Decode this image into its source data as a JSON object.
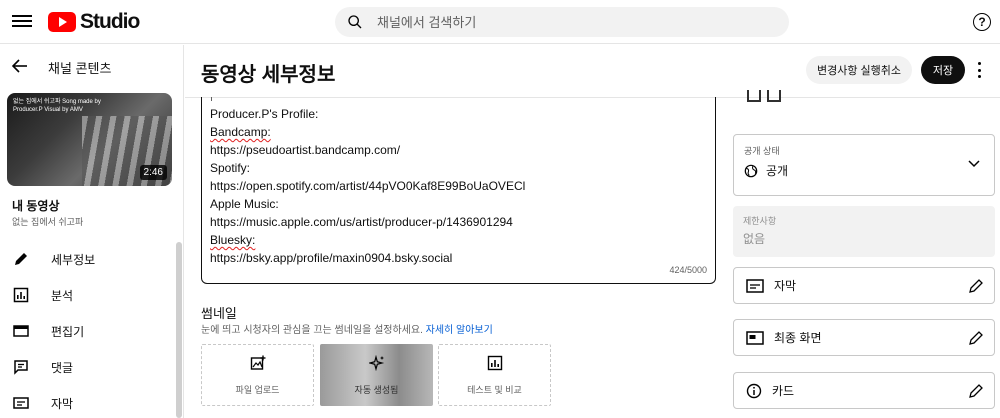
{
  "app": {
    "logo_text": "Studio"
  },
  "search": {
    "placeholder": "채널에서 검색하기"
  },
  "help_icon_text": "?",
  "sidebar": {
    "back_label": "채널 콘텐츠",
    "thumbnail_overlay_text": "없는 집에서 쉬고파 Song made by Producer.P Visual by AMV",
    "duration": "2:46",
    "video_heading": "내 동영상",
    "video_title": "없는 집에서 쉬고파",
    "nav": [
      {
        "label": "세부정보",
        "icon": "pencil-icon"
      },
      {
        "label": "분석",
        "icon": "analytics-icon"
      },
      {
        "label": "편집기",
        "icon": "film-icon"
      },
      {
        "label": "댓글",
        "icon": "comment-icon"
      },
      {
        "label": "자막",
        "icon": "subtitles-icon"
      }
    ]
  },
  "header": {
    "title": "동영상 세부정보",
    "undo_label": "변경사항 실행취소",
    "save_label": "저장"
  },
  "description": {
    "lines": [
      "Producer.P's Profile:",
      "Bandcamp:",
      "https://pseudoartist.bandcamp.com/",
      "Spotify:",
      "https://open.spotify.com/artist/44pVO0Kaf8E99BoUaOVECl",
      "Apple Music:",
      "https://music.apple.com/us/artist/producer-p/1436901294",
      "Bluesky:",
      "https://bsky.app/profile/maxin0904.bsky.social"
    ],
    "char_count": "424/5000"
  },
  "thumbnail": {
    "title": "썸네일",
    "subtitle": "눈에 띄고 시청자의 관심을 끄는 썸네일을 설정하세요.",
    "learn_more": "자세히 알아보기",
    "options": [
      {
        "label": "파일 업로드",
        "icon": "add-photo-icon"
      },
      {
        "label": "자동 생성됨",
        "icon": "sparkle-icon"
      },
      {
        "label": "테스트 및 비교",
        "icon": "chart-icon"
      }
    ]
  },
  "right": {
    "visibility": {
      "label": "공개 상태",
      "value": "공개",
      "icon": "globe-icon"
    },
    "restrictions": {
      "label": "제한사항",
      "value": "없음"
    },
    "rows": [
      {
        "label": "자막",
        "icon": "subtitles-icon"
      },
      {
        "label": "최종 화면",
        "icon": "end-screen-icon"
      },
      {
        "label": "카드",
        "icon": "info-icon"
      }
    ]
  },
  "colors": {
    "accent_link": "#065fd4",
    "logo_red": "#ff0000",
    "save_bg": "#0f0f0f"
  }
}
